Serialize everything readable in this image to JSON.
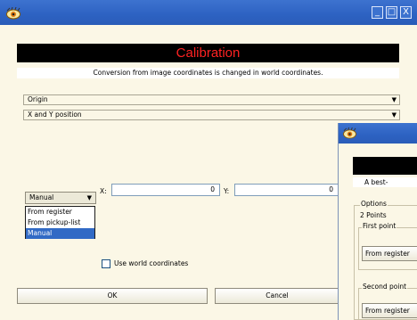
{
  "main_window": {
    "caption_buttons": {
      "minimize": "_",
      "maximize": "□",
      "close": "X"
    },
    "banner_title": "Calibration",
    "subtitle": "Conversion from image coordinates is changed in world coordinates.",
    "select_origin": "Origin",
    "select_position": "X and Y position",
    "source_select": {
      "value": "Manual",
      "options": [
        "From register",
        "From pickup-list",
        "Manual"
      ]
    },
    "x_label": "X:",
    "x_value": "0",
    "y_label": "Y:",
    "y_value": "0",
    "checkbox_label": "Use world coordinates",
    "ok_label": "OK",
    "cancel_label": "Cancel"
  },
  "second_window": {
    "subtitle_visible": "A best-",
    "options_label": "Options",
    "points_value": "2 Points",
    "first_point_label": "First point",
    "first_from_register": "From register",
    "second_point_label": "Second point",
    "second_from_register": "From register"
  },
  "colors": {
    "titlebar": "#2d62c2",
    "banner_bg": "#000000",
    "banner_text": "#ff2222",
    "window_bg": "#fbf7e6",
    "selection": "#316ac5"
  },
  "icons": {
    "app": "eye-icon"
  }
}
